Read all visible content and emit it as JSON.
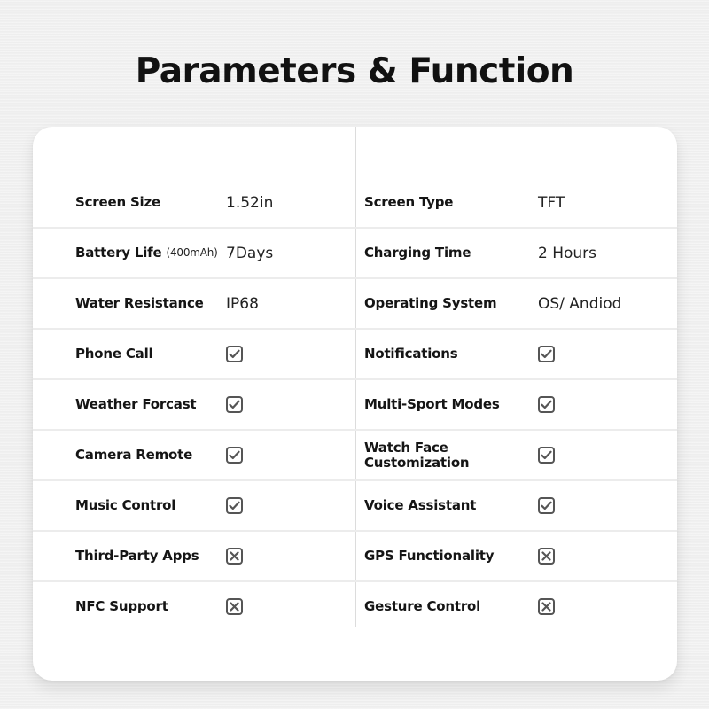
{
  "title": "Parameters & Function",
  "colors": {
    "background": "#efefef",
    "card": "#ffffff",
    "text": "#151515",
    "icon": "#555555",
    "divider": "#ececec"
  },
  "rows": [
    {
      "left": {
        "label": "Screen Size",
        "sub": "",
        "type": "text",
        "value": "1.52in"
      },
      "right": {
        "label": "Screen Type",
        "sub": "",
        "type": "text",
        "value": "TFT"
      }
    },
    {
      "left": {
        "label": "Battery Life",
        "sub": "(400mAh)",
        "type": "text",
        "value": "7Days"
      },
      "right": {
        "label": "Charging Time",
        "sub": "",
        "type": "text",
        "value": "2 Hours"
      }
    },
    {
      "left": {
        "label": "Water Resistance",
        "sub": "",
        "type": "text",
        "value": "IP68"
      },
      "right": {
        "label": "Operating System",
        "sub": "",
        "type": "text",
        "value": "OS/ Andiod"
      }
    },
    {
      "left": {
        "label": "Phone Call",
        "sub": "",
        "type": "icon",
        "value": "check-icon"
      },
      "right": {
        "label": "Notifications",
        "sub": "",
        "type": "icon",
        "value": "check-icon"
      }
    },
    {
      "left": {
        "label": "Weather Forcast",
        "sub": "",
        "type": "icon",
        "value": "check-icon"
      },
      "right": {
        "label": "Multi-Sport Modes",
        "sub": "",
        "type": "icon",
        "value": "check-icon"
      }
    },
    {
      "left": {
        "label": "Camera Remote",
        "sub": "",
        "type": "icon",
        "value": "check-icon"
      },
      "right": {
        "label": "Watch Face Customization",
        "sub": "",
        "type": "icon",
        "value": "check-icon"
      }
    },
    {
      "left": {
        "label": "Music Control",
        "sub": "",
        "type": "icon",
        "value": "check-icon"
      },
      "right": {
        "label": "Voice Assistant",
        "sub": "",
        "type": "icon",
        "value": "check-icon"
      }
    },
    {
      "left": {
        "label": "Third-Party Apps",
        "sub": "",
        "type": "icon",
        "value": "cross-icon"
      },
      "right": {
        "label": "GPS Functionality",
        "sub": "",
        "type": "icon",
        "value": "cross-icon"
      }
    },
    {
      "left": {
        "label": "NFC Support",
        "sub": "",
        "type": "icon",
        "value": "cross-icon"
      },
      "right": {
        "label": "Gesture Control",
        "sub": "",
        "type": "icon",
        "value": "cross-icon"
      }
    }
  ]
}
